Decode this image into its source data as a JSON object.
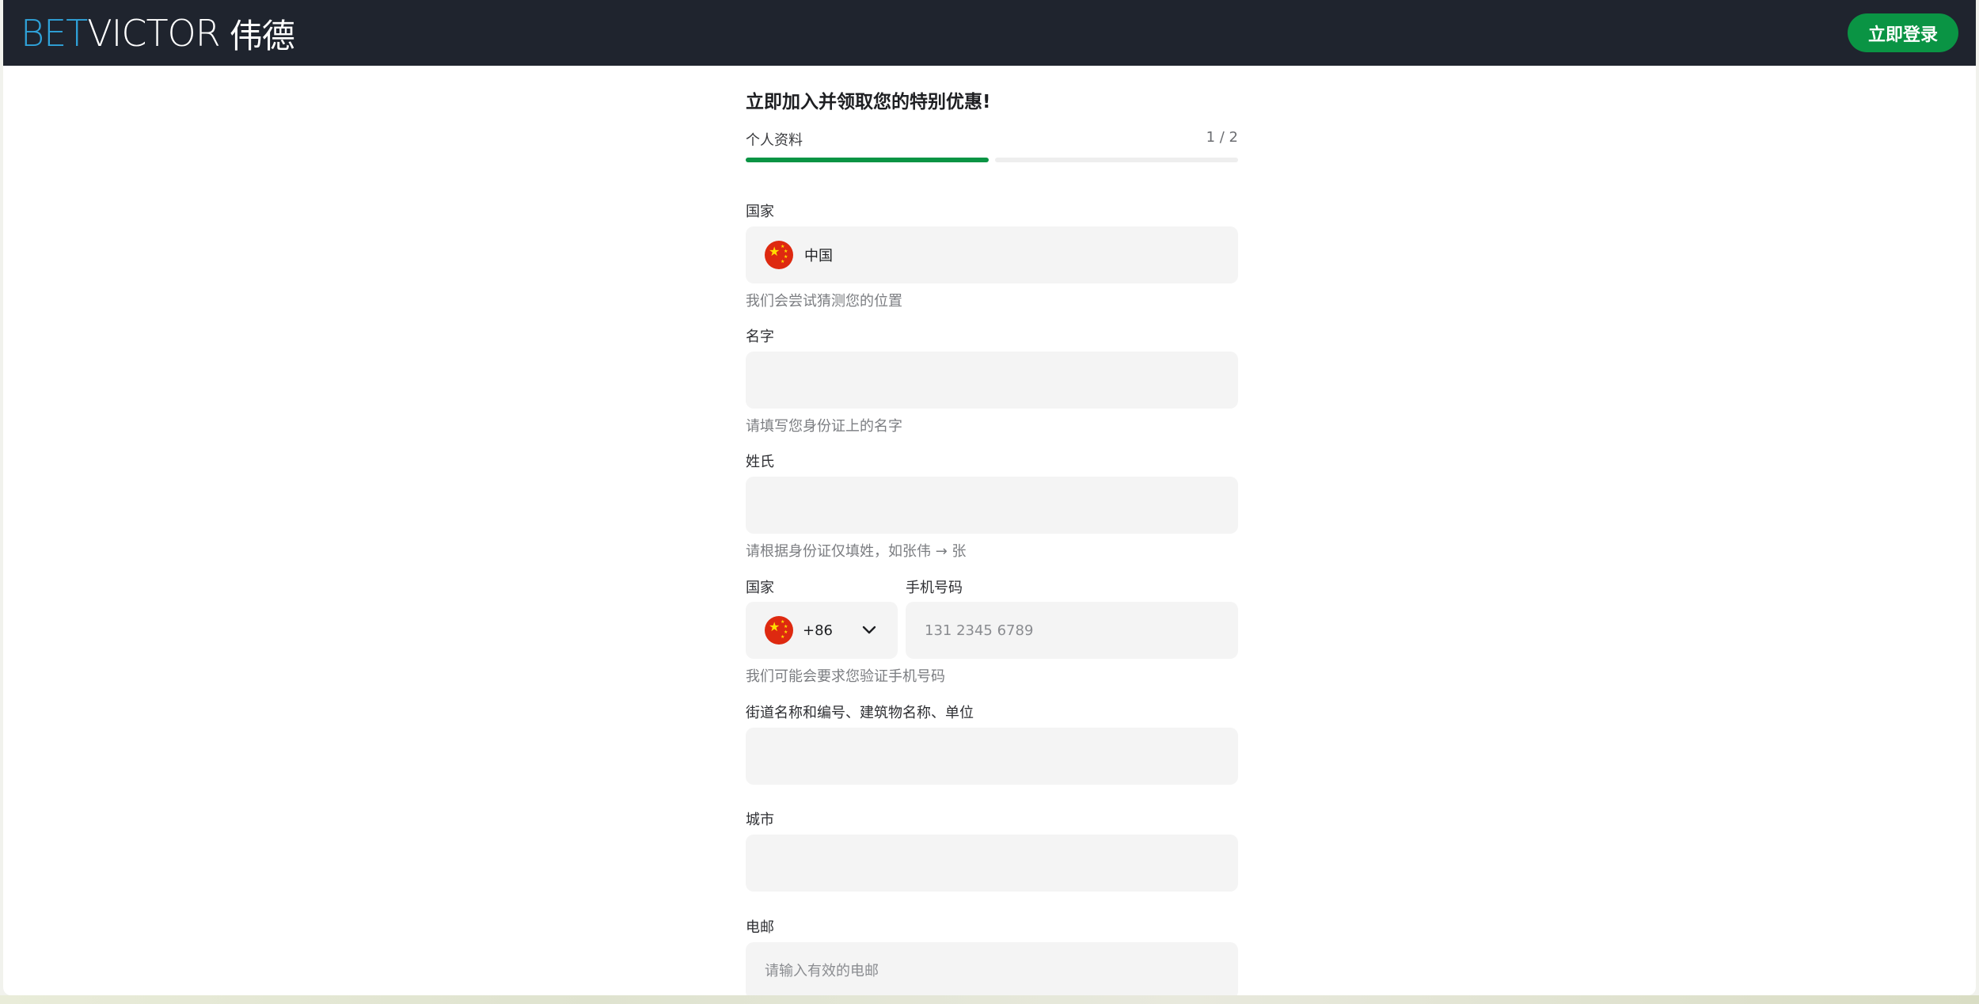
{
  "header": {
    "logo_bet": "BET",
    "logo_victor": "VICTOR",
    "logo_cn": "伟德",
    "login_label": "立即登录"
  },
  "form": {
    "title": "立即加入并领取您的特别优惠!",
    "step_label": "个人资料",
    "step_count": "1 / 2",
    "progress_fraction": 0.5,
    "country": {
      "label": "国家",
      "value": "中国",
      "help": "我们会尝试猜测您的位置",
      "flag_icon": "china-flag-icon"
    },
    "first_name": {
      "label": "名字",
      "value": "",
      "placeholder": "",
      "help": "请填写您身份证上的名字"
    },
    "last_name": {
      "label": "姓氏",
      "value": "",
      "placeholder": "",
      "help": "请根据身份证仅填姓，如张伟 → 张"
    },
    "phone": {
      "country_label": "国家",
      "country_code": "+86",
      "number_label": "手机号码",
      "placeholder": "131 2345 6789",
      "help": "我们可能会要求您验证手机号码"
    },
    "street": {
      "label": "街道名称和编号、建筑物名称、单位",
      "value": "",
      "placeholder": ""
    },
    "city": {
      "label": "城市",
      "value": "",
      "placeholder": ""
    },
    "email": {
      "label": "电邮",
      "value": "",
      "placeholder": "请输入有效的电邮"
    }
  },
  "colors": {
    "header_bg": "#1f242e",
    "accent_green": "#0a9444",
    "logo_blue": "#2fa3da",
    "field_bg": "#f4f4f4"
  }
}
